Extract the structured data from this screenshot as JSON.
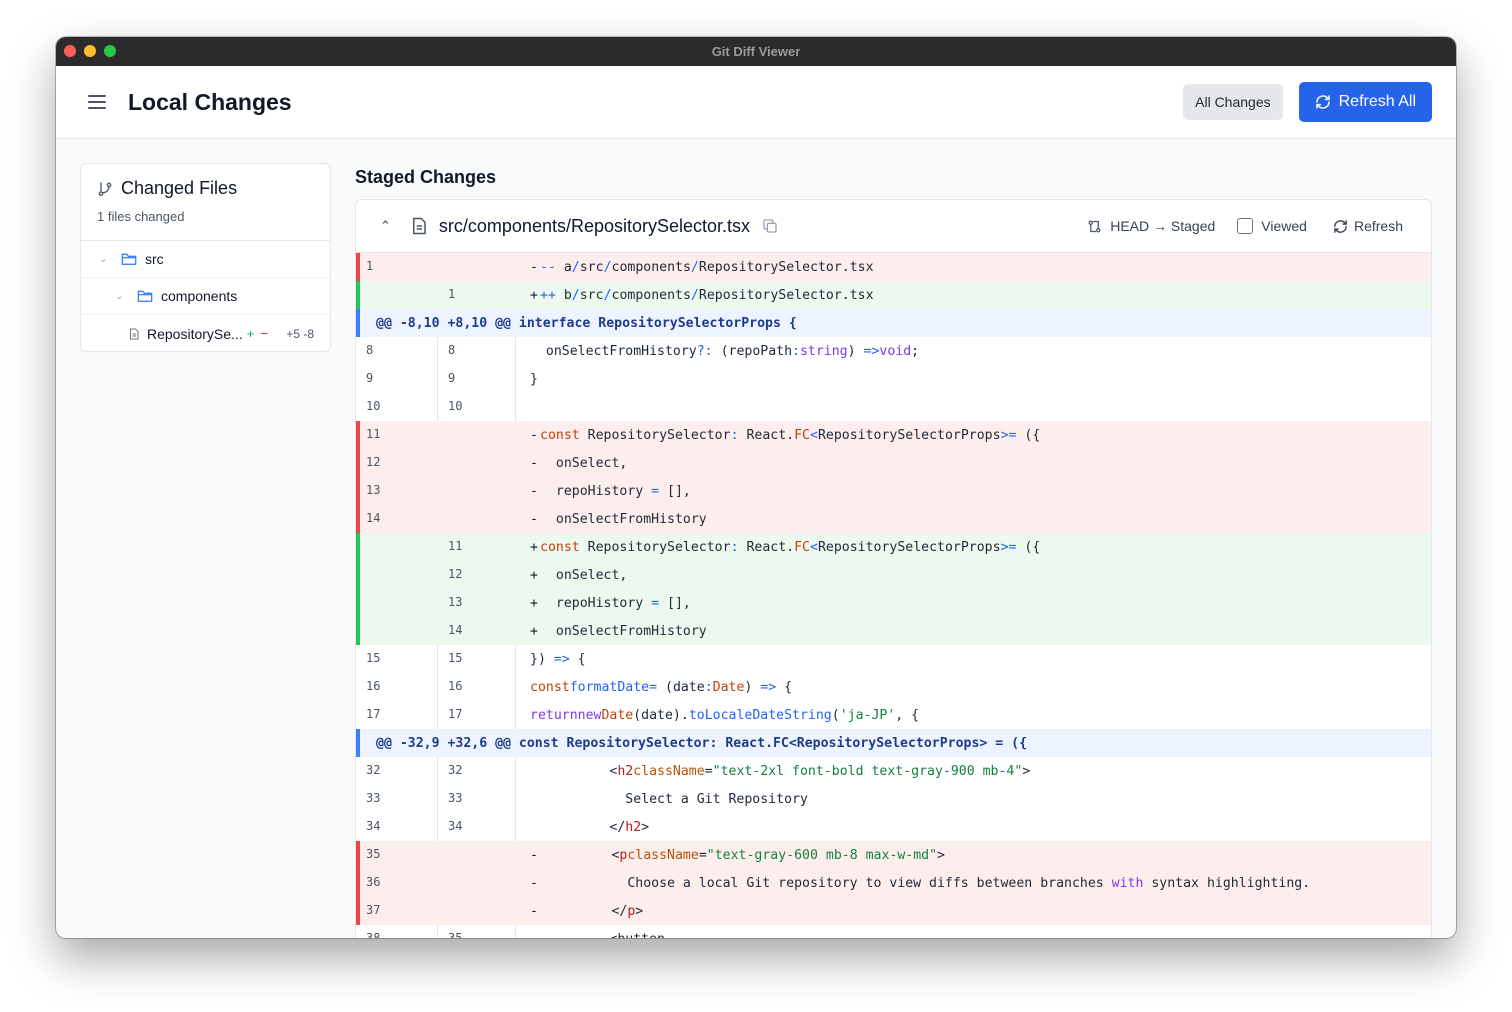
{
  "window": {
    "title": "Git Diff Viewer"
  },
  "header": {
    "title": "Local Changes",
    "all_changes_label": "All Changes",
    "refresh_all_label": "Refresh All"
  },
  "sidebar": {
    "title": "Changed Files",
    "subtitle": "1 files changed",
    "tree": {
      "folder1": "src",
      "folder2": "components",
      "file": "RepositorySe...",
      "plus": "+",
      "minus": "−",
      "stats": "+5 -8"
    }
  },
  "main": {
    "section_title": "Staged Changes",
    "file": {
      "path": "src/components/RepositorySelector.tsx",
      "compare": "HEAD → Staged",
      "viewed_label": "Viewed",
      "refresh_label": "Refresh"
    }
  },
  "colors": {
    "accent": "#2563eb",
    "deleted_bg": "#fdeeee",
    "added_bg": "#edf9ef",
    "hunk_bg": "#eef4ff"
  }
}
